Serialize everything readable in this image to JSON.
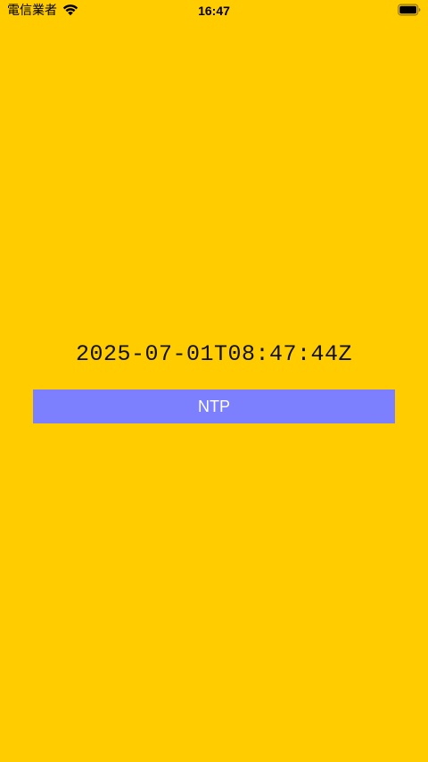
{
  "status_bar": {
    "carrier": "電信業者",
    "time": "16:47",
    "wifi_icon": "wifi-icon",
    "battery_icon": "battery-icon",
    "battery_level": 1.0
  },
  "main": {
    "timestamp": "2025-07-01T08:47:44Z",
    "ntp_button_label": "NTP"
  },
  "colors": {
    "background": "#FFCC00",
    "button": "#7C80FF",
    "button_text": "#FFFFFF"
  }
}
